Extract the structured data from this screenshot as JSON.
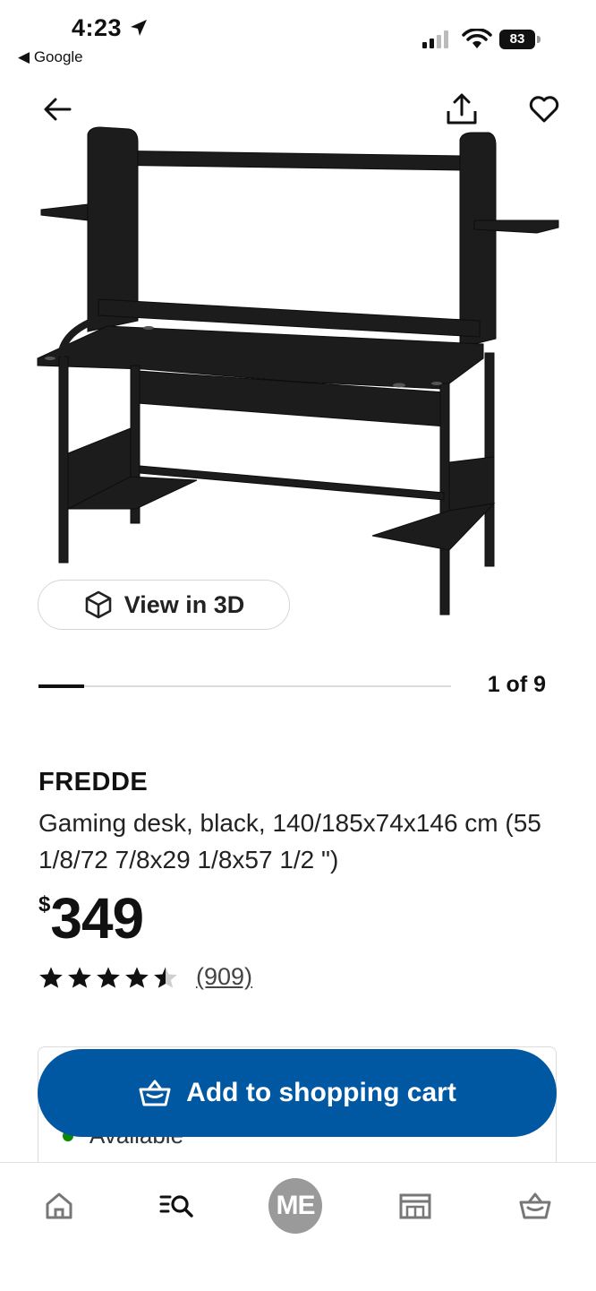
{
  "status_bar": {
    "time": "4:23",
    "back_app": "Google",
    "battery": "83"
  },
  "product": {
    "brand": "FREDDE",
    "description": "Gaming desk, black, 140/185x74x146 cm (55 1/8/72 7/8x29 1/8x57 1/2 \")",
    "price_currency": "$",
    "price_amount": "349",
    "rating": 4.5,
    "review_count": "(909)"
  },
  "gallery": {
    "view_3d_label": "View in 3D",
    "pager": "1 of 9",
    "progress": 0.11
  },
  "availability": {
    "text": "Available",
    "status_color": "#0a8a00"
  },
  "cart": {
    "label": "Add to shopping cart",
    "color": "#0058a3"
  },
  "bottom_nav": {
    "profile_initials": "ME"
  }
}
